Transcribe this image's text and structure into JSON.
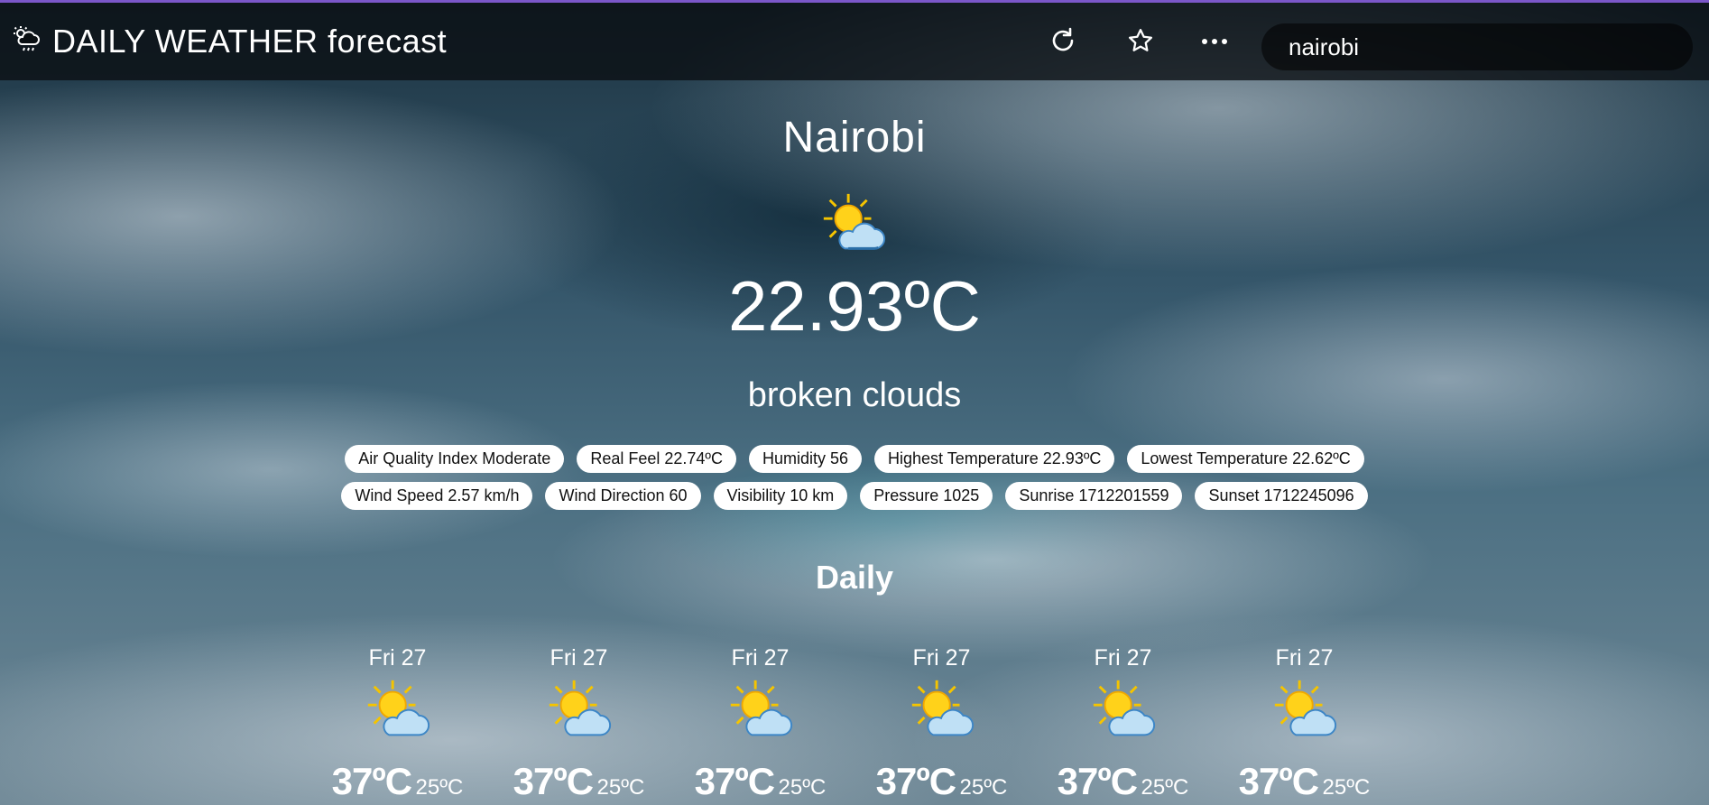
{
  "app": {
    "title": "DAILY WEATHER forecast",
    "logo_icon": "cloud-sun-rain-icon"
  },
  "toolbar": {
    "refresh_icon": "refresh-icon",
    "favorite_icon": "star-icon",
    "more_icon": "more-horizontal-icon"
  },
  "search": {
    "value": "nairobi"
  },
  "current": {
    "city": "Nairobi",
    "icon": "partly-cloudy-sun-icon",
    "temperature": "22.93ºC",
    "description": "broken clouds"
  },
  "details_row1": [
    "Air Quality Index Moderate",
    "Real Feel 22.74ºC",
    "Humidity 56",
    "Highest Temperature 22.93ºC",
    "Lowest Temperature 22.62ºC"
  ],
  "details_row2": [
    "Wind Speed 2.57 km/h",
    "Wind Direction 60",
    "Visibility 10 km",
    "Pressure 1025",
    "Sunrise 1712201559",
    "Sunset 1712245096"
  ],
  "daily": {
    "title": "Daily",
    "days": [
      {
        "label": "Fri 27",
        "high": "37ºC",
        "low": "25ºC",
        "icon": "partly-cloudy-sun-icon"
      },
      {
        "label": "Fri 27",
        "high": "37ºC",
        "low": "25ºC",
        "icon": "partly-cloudy-sun-icon"
      },
      {
        "label": "Fri 27",
        "high": "37ºC",
        "low": "25ºC",
        "icon": "partly-cloudy-sun-icon"
      },
      {
        "label": "Fri 27",
        "high": "37ºC",
        "low": "25ºC",
        "icon": "partly-cloudy-sun-icon"
      },
      {
        "label": "Fri 27",
        "high": "37ºC",
        "low": "25ºC",
        "icon": "partly-cloudy-sun-icon"
      },
      {
        "label": "Fri 27",
        "high": "37ºC",
        "low": "25ºC",
        "icon": "partly-cloudy-sun-icon"
      }
    ]
  },
  "colors": {
    "navbar": "#0a0e12",
    "accent_line": "#7b57c9",
    "chip_bg": "#ffffff",
    "chip_text": "#111111"
  }
}
